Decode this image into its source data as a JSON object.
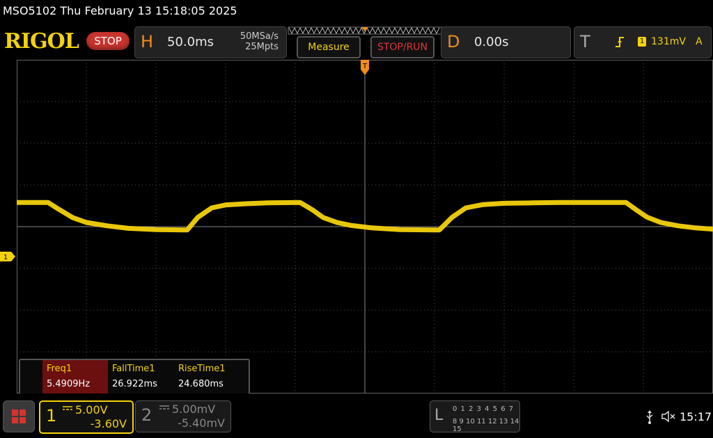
{
  "title": "MSO5102  Thu February 13 15:18:05 2025",
  "brand": "RIGOL",
  "status_button": "STOP",
  "horizontal": {
    "letter": "H",
    "timebase": "50.0ms",
    "sample_rate": "50MSa/s",
    "memory_depth": "25Mpts"
  },
  "buttons": {
    "measure": "Measure",
    "stop_run": "STOP/RUN"
  },
  "delay": {
    "letter": "D",
    "value": "0.00s"
  },
  "trigger": {
    "letter": "T",
    "source": "1",
    "level": "131mV",
    "mode": "A",
    "marker": "T"
  },
  "channel_marker": "1",
  "measurements": {
    "headers": [
      "Freq1",
      "FallTime1",
      "RiseTime1"
    ],
    "values": [
      "5.4909Hz",
      "26.922ms",
      "24.680ms"
    ]
  },
  "channels": [
    {
      "number": "1",
      "scale": "5.00V",
      "offset": "-3.60V",
      "color": "#f4d20b",
      "active": true
    },
    {
      "number": "2",
      "scale": "5.00mV",
      "offset": "-5.40mV",
      "color": "#888888",
      "active": false
    }
  ],
  "logic_analyzer": {
    "letter": "L",
    "row1": "0 1 2 3  4 5 6 7",
    "row2": "8 9 10 11 12 13 14 15"
  },
  "clock": "15:17",
  "chart_data": {
    "type": "line",
    "description_units": "screen divisions",
    "x_divisions": 10,
    "y_divisions": 8,
    "series": [
      {
        "color": "#f4d20b",
        "x": [
          0,
          0.45,
          0.6,
          0.8,
          1.0,
          1.3,
          1.6,
          2.0,
          2.4,
          2.45,
          2.6,
          2.8,
          3.0,
          3.3,
          3.6,
          4.07,
          4.25,
          4.4,
          4.6,
          4.8,
          5.1,
          5.5,
          6.0,
          6.07,
          6.25,
          6.45,
          6.7,
          7.0,
          7.4,
          7.8,
          8.2,
          8.75,
          8.9,
          9.05,
          9.25,
          9.5,
          9.75,
          10.0
        ],
        "y": [
          0.58,
          0.58,
          0.42,
          0.22,
          0.1,
          0.02,
          -0.04,
          -0.07,
          -0.08,
          -0.08,
          0.22,
          0.45,
          0.52,
          0.55,
          0.57,
          0.58,
          0.4,
          0.22,
          0.1,
          0.03,
          -0.03,
          -0.07,
          -0.08,
          -0.08,
          0.22,
          0.45,
          0.53,
          0.56,
          0.57,
          0.58,
          0.58,
          0.58,
          0.4,
          0.23,
          0.1,
          0.02,
          -0.03,
          -0.06
        ]
      }
    ]
  }
}
